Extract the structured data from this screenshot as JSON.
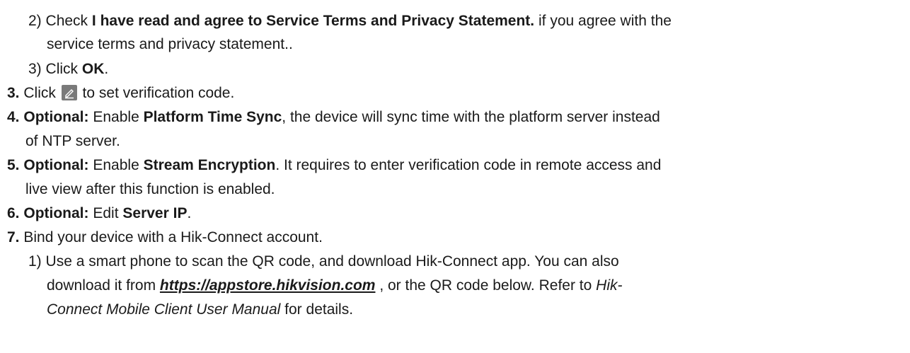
{
  "substeps_a": {
    "s2": {
      "num": "2)",
      "pre": "Check",
      "bold": "I have read and agree to Service Terms and Privacy Statement.",
      "post": "if you agree with the",
      "cont": "service terms and privacy statement.."
    },
    "s3": {
      "num": "3)",
      "pre": "Click",
      "bold": "OK",
      "post": "."
    }
  },
  "steps": {
    "step3": {
      "num": "3.",
      "pre": "Click",
      "icon": "edit-icon",
      "post": "to set verification code."
    },
    "step4": {
      "num": "4.",
      "optional": "Optional:",
      "pre": "Enable",
      "bold": "Platform Time Sync",
      "post": ", the device will sync time with the platform server instead",
      "cont": "of NTP server."
    },
    "step5": {
      "num": "5.",
      "optional": "Optional:",
      "pre": "Enable",
      "bold": "Stream Encryption",
      "post": ". It requires to enter verification code in remote access and",
      "cont": "live view after this function is enabled."
    },
    "step6": {
      "num": "6.",
      "optional": "Optional:",
      "pre": "Edit",
      "bold": "Server IP",
      "post": "."
    },
    "step7": {
      "num": "7.",
      "text": "Bind your device with a Hik-Connect account."
    }
  },
  "substeps_b": {
    "s1": {
      "num": "1)",
      "line1": "Use a smart phone to scan the QR code, and download Hik-Connect app. You can also",
      "line2_pre": "download it from",
      "link": "https://appstore.hikvision.com",
      "line2_post": ", or the QR code below. Refer to",
      "italic_a": "Hik-",
      "italic_b": "Connect Mobile Client User Manual",
      "line3_post": "for details."
    }
  }
}
